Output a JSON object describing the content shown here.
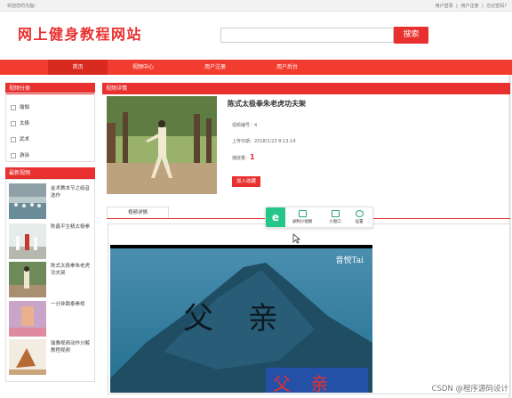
{
  "topbar": {
    "welcome": "欢迎您的光临!",
    "links": [
      "用户登录",
      "|",
      "用户注册",
      "|",
      "忘记密码?"
    ]
  },
  "header": {
    "logo": "网上健身教程网站",
    "search_placeholder": "",
    "search_button": "搜索"
  },
  "nav": {
    "items": [
      "首页",
      "视频中心",
      "用户注册",
      "用户后台"
    ]
  },
  "sidebar": {
    "categories_title": "视频分类",
    "categories": [
      "瑜伽",
      "太极",
      "武术",
      "游泳"
    ],
    "latest_title": "最新视频",
    "latest": [
      "金术赛本节之组音选作",
      "陈鑫平生精太极拳",
      "陈式太极拳朱老虎功夫架",
      "一分钟跳泰拳视",
      "瑜雅视频动作分解教程视频"
    ]
  },
  "detail": {
    "section_title": "视频详情",
    "video_title": "陈式太极拳朱老虎功夫架",
    "id_label": "视频编号：",
    "id_value": "4",
    "date_label": "上传日期：",
    "date_value": "2018/1/23 8:13:14",
    "plays_label": "播放量：",
    "plays_value": "1",
    "favorite_button": "加入收藏",
    "tab_label": "视频详情"
  },
  "floatbar": {
    "brand": "e",
    "items": [
      "录制小视频",
      "小窗口",
      "设置"
    ]
  },
  "player": {
    "top_right_text": "音悦Tai",
    "center_text": "父 亲",
    "bottom_text": "父 亲"
  },
  "watermark": "CSDN @程序源码设计",
  "colors": {
    "accent": "#e8302e",
    "nav": "#f23c2f",
    "float_green": "#24c789"
  }
}
